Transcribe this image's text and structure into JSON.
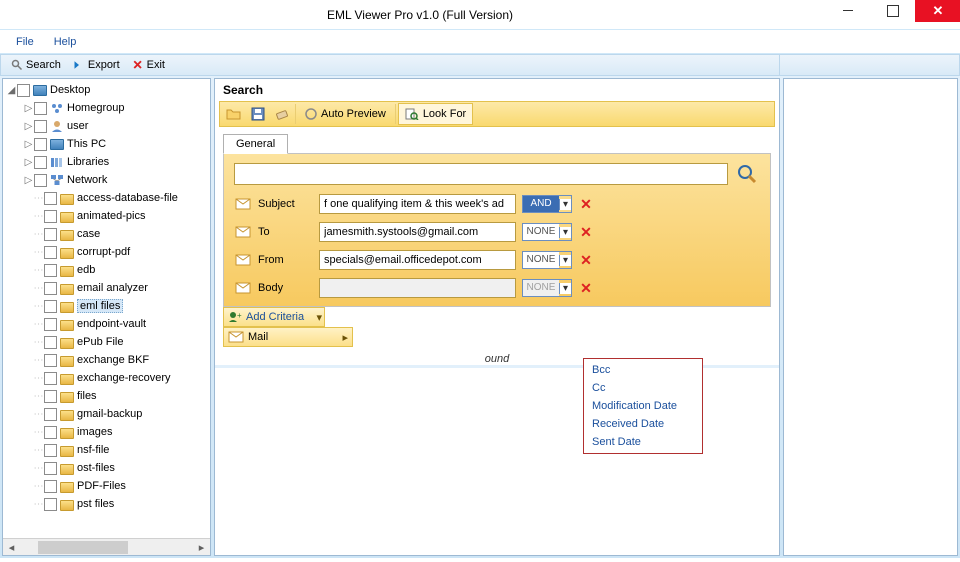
{
  "window": {
    "title": "EML Viewer Pro v1.0 (Full Version)"
  },
  "menu": {
    "file": "File",
    "help": "Help"
  },
  "toolbar": {
    "search": "Search",
    "export": "Export",
    "exit": "Exit"
  },
  "tree": {
    "root": "Desktop",
    "top": [
      {
        "label": "Homegroup",
        "icon": "homegroup"
      },
      {
        "label": "user",
        "icon": "user"
      },
      {
        "label": "This PC",
        "icon": "pc"
      },
      {
        "label": "Libraries",
        "icon": "libraries"
      },
      {
        "label": "Network",
        "icon": "network"
      }
    ],
    "folders": [
      "access-database-file",
      "animated-pics",
      "case",
      "corrupt-pdf",
      "edb",
      "email analyzer",
      "eml files",
      "endpoint-vault",
      "ePub File",
      "exchange BKF",
      "exchange-recovery",
      "files",
      "gmail-backup",
      "images",
      "nsf-file",
      "ost-files",
      "PDF-Files",
      "pst files"
    ],
    "selected": "eml files"
  },
  "center": {
    "title": "Search",
    "auto_preview": "Auto Preview",
    "look_for": "Look For",
    "tab_general": "General",
    "add_criteria": "Add Criteria",
    "mail": "Mail",
    "found": "ound"
  },
  "criteria": {
    "subject_label": "Subject",
    "subject_value": "f one qualifying item & this week's ad",
    "subject_op": "AND",
    "to_label": "To",
    "to_value": "jamesmith.systools@gmail.com",
    "to_op": "NONE",
    "from_label": "From",
    "from_value": "specials@email.officedepot.com",
    "from_op": "NONE",
    "body_label": "Body",
    "body_value": "",
    "body_op": "NONE"
  },
  "submenu": {
    "bcc": "Bcc",
    "cc": "Cc",
    "mod_date": "Modification Date",
    "recv_date": "Received Date",
    "sent_date": "Sent Date"
  }
}
